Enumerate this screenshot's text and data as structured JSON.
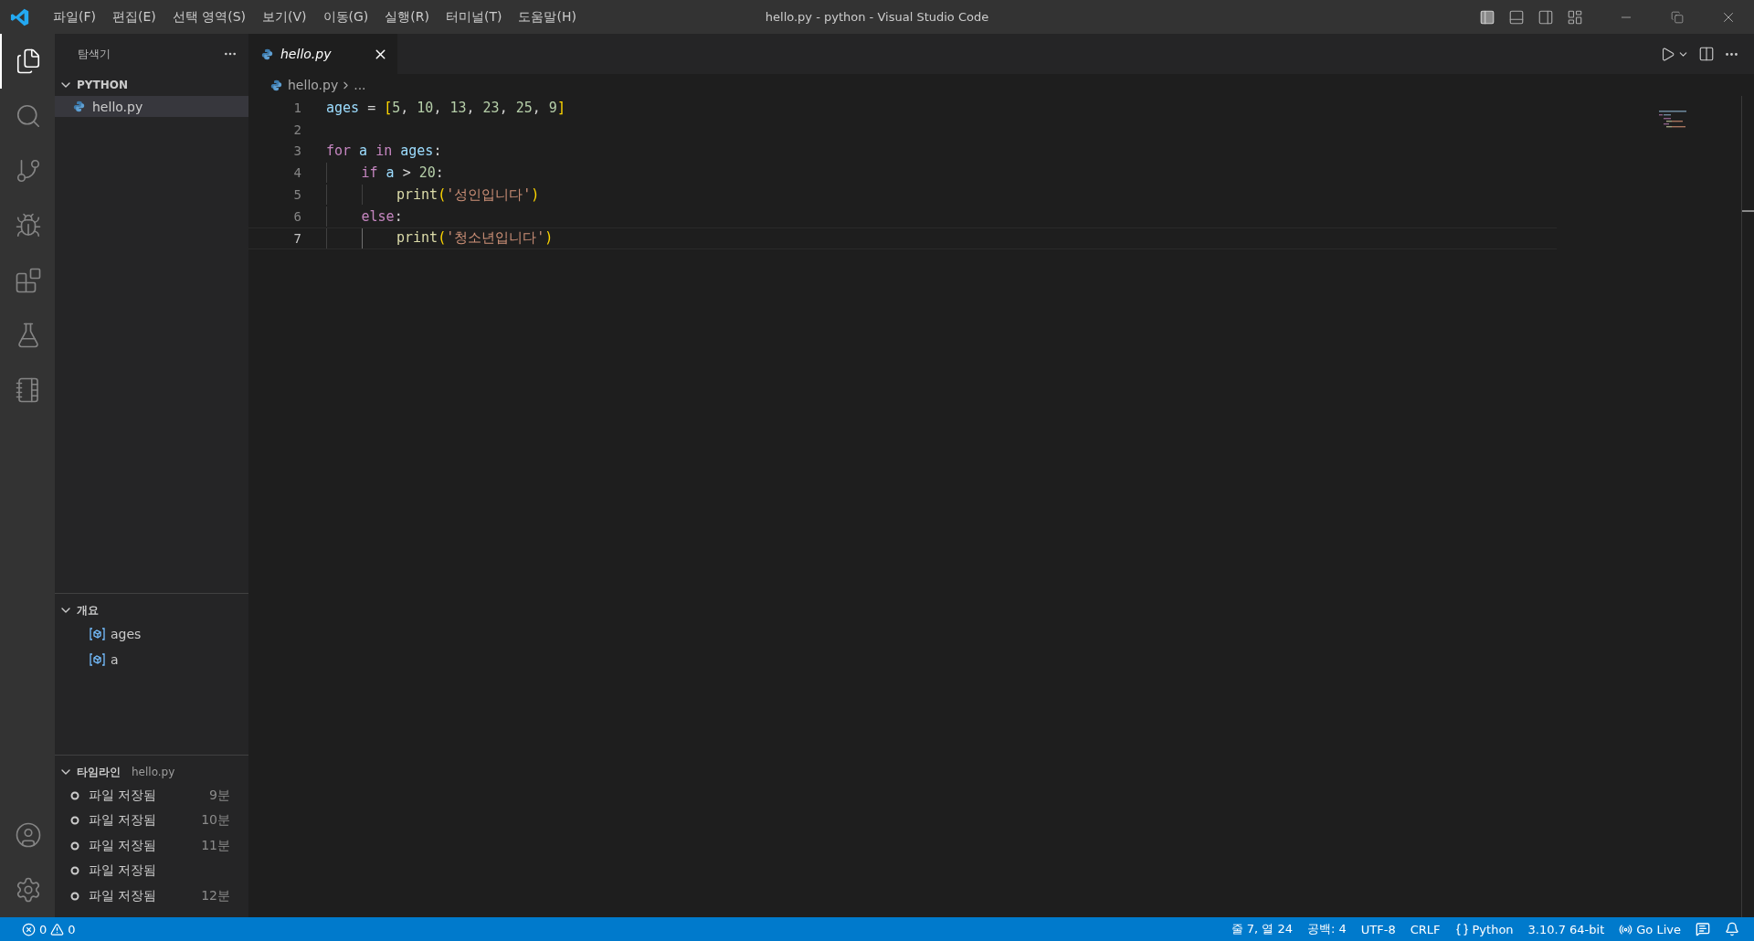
{
  "title_bar": {
    "menu": [
      "파일(F)",
      "편집(E)",
      "선택 영역(S)",
      "보기(V)",
      "이동(G)",
      "실행(R)",
      "터미널(T)",
      "도움말(H)"
    ],
    "title": "hello.py - python - Visual Studio Code",
    "layout_toggles": [
      {
        "kind": "primary-sidebar",
        "on": true
      },
      {
        "kind": "panel",
        "on": false
      },
      {
        "kind": "secondary-sidebar",
        "on": false
      },
      {
        "kind": "customize",
        "on": false
      }
    ]
  },
  "activity_bar": {
    "top": [
      {
        "kind": "explorer",
        "selected": true
      },
      {
        "kind": "search",
        "selected": false
      },
      {
        "kind": "source-control",
        "selected": false
      },
      {
        "kind": "run-debug",
        "selected": false
      },
      {
        "kind": "extensions",
        "selected": false
      },
      {
        "kind": "testing",
        "selected": false
      },
      {
        "kind": "notebook",
        "selected": false
      }
    ],
    "bottom": [
      {
        "kind": "accounts"
      },
      {
        "kind": "manage"
      }
    ]
  },
  "sidebar": {
    "title": "탐색기",
    "folder": {
      "label": "PYTHON",
      "expanded": true,
      "files": [
        {
          "name": "hello.py",
          "selected": true
        }
      ]
    },
    "outline": {
      "label": "개요",
      "expanded": true,
      "items": [
        "ages",
        "a"
      ]
    },
    "timeline": {
      "label": "타임라인",
      "file": "hello.py",
      "expanded": true,
      "entries": [
        {
          "label": "파일 저장됨",
          "time": "9분"
        },
        {
          "label": "파일 저장됨",
          "time": "10분"
        },
        {
          "label": "파일 저장됨",
          "time": "11분"
        },
        {
          "label": "파일 저장됨"
        },
        {
          "label": "파일 저장됨",
          "time": "12분"
        }
      ]
    }
  },
  "editor": {
    "tabs": [
      {
        "label": "hello.py",
        "selected": true,
        "preview": true
      }
    ],
    "breadcrumb": [
      "hello.py",
      "..."
    ],
    "lines": [
      {
        "number": "1",
        "current": false,
        "tokens": [
          {
            "kind": "var",
            "text": "ages"
          },
          {
            "kind": "op",
            "text": " = "
          },
          {
            "kind": "bracket",
            "text": "["
          },
          {
            "kind": "num",
            "text": "5"
          },
          {
            "kind": "op",
            "text": ", "
          },
          {
            "kind": "num",
            "text": "10"
          },
          {
            "kind": "op",
            "text": ", "
          },
          {
            "kind": "num",
            "text": "13"
          },
          {
            "kind": "op",
            "text": ", "
          },
          {
            "kind": "num",
            "text": "23"
          },
          {
            "kind": "op",
            "text": ", "
          },
          {
            "kind": "num",
            "text": "25"
          },
          {
            "kind": "op",
            "text": ", "
          },
          {
            "kind": "num",
            "text": "9"
          },
          {
            "kind": "bracket",
            "text": "]"
          }
        ]
      },
      {
        "number": "2",
        "current": false
      },
      {
        "number": "3",
        "current": false,
        "tokens": [
          {
            "kind": "keyword",
            "text": "for"
          },
          {
            "kind": "var",
            "text": " a"
          },
          {
            "kind": "keyword",
            "text": " in"
          },
          {
            "kind": "var",
            "text": " ages"
          },
          {
            "kind": "op",
            "text": ":"
          }
        ]
      },
      {
        "number": "4",
        "current": false,
        "tokens": [
          {
            "kind": "keyword",
            "text": "    if"
          },
          {
            "kind": "var",
            "text": " a"
          },
          {
            "kind": "op",
            "text": " > "
          },
          {
            "kind": "num",
            "text": "20"
          },
          {
            "kind": "op",
            "text": ":"
          }
        ]
      },
      {
        "number": "5",
        "current": false,
        "tokens": [
          {
            "kind": "func",
            "text": "        print"
          },
          {
            "kind": "bracket",
            "text": "("
          },
          {
            "kind": "str",
            "text": "'성인입니다'"
          },
          {
            "kind": "bracket",
            "text": ")"
          }
        ]
      },
      {
        "number": "6",
        "current": false,
        "tokens": [
          {
            "kind": "keyword",
            "text": "    else"
          },
          {
            "kind": "op",
            "text": ":"
          }
        ]
      },
      {
        "number": "7",
        "current": true,
        "tokens": [
          {
            "kind": "func",
            "text": "        print"
          },
          {
            "kind": "bracket",
            "text": "("
          },
          {
            "kind": "str",
            "text": "'청소년입니다'"
          },
          {
            "kind": "bracket",
            "text": ")"
          }
        ]
      }
    ]
  },
  "status_bar": {
    "errors": "0",
    "warnings": "0",
    "right": [
      {
        "kind": "text",
        "text": "줄 7, 열 24"
      },
      {
        "kind": "text",
        "text": "공백: 4"
      },
      {
        "kind": "text",
        "text": "UTF-8"
      },
      {
        "kind": "text",
        "text": "CRLF"
      },
      {
        "kind": "language",
        "text": "Python"
      },
      {
        "kind": "text",
        "text": "3.10.7 64-bit"
      },
      {
        "kind": "live",
        "text": "Go Live"
      }
    ]
  }
}
